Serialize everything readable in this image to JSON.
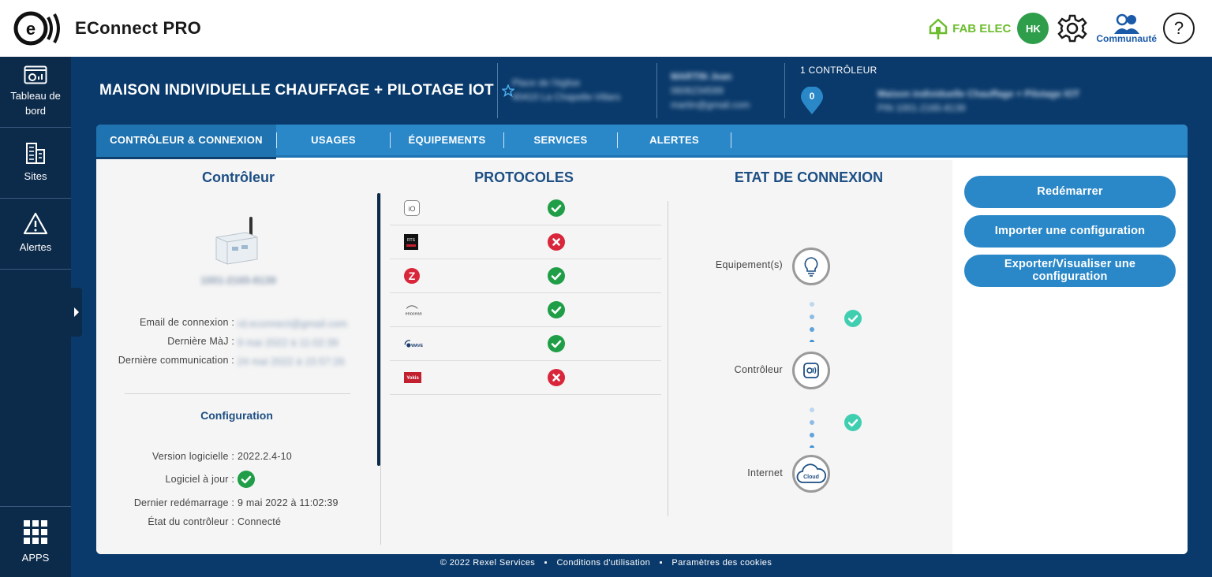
{
  "app": {
    "title": "EConnect PRO"
  },
  "topbar": {
    "brand_label": "FAB ELEC",
    "avatar_initials": "HK",
    "community_label": "Communauté",
    "help_symbol": "?"
  },
  "sidebar": {
    "items": [
      {
        "label": "Tableau de bord",
        "icon": "dashboard-icon"
      },
      {
        "label": "Sites",
        "icon": "buildings-icon"
      },
      {
        "label": "Alertes",
        "icon": "warning-icon"
      }
    ],
    "apps_label": "APPS"
  },
  "site": {
    "title": "MAISON INDIVIDUELLE CHAUFFAGE + PILOTAGE IOT",
    "address_line1": "Place de l'église",
    "address_line2": "40410 La Chapelle-Villars",
    "contact_name": "MARTIN Jean",
    "contact_phone": "0606234599",
    "contact_email": "martin@gmail.com",
    "controller_count_label": "1 CONTRÔLEUR",
    "controller_pin_value": "0",
    "controller_name": "Maison individuelle Chauffage + Pilotage IOT",
    "controller_pin": "PIN 1001-2165-8139"
  },
  "tabs": [
    {
      "label": "CONTRÔLEUR & CONNEXION",
      "active": true
    },
    {
      "label": "USAGES",
      "active": false
    },
    {
      "label": "ÉQUIPEMENTS",
      "active": false
    },
    {
      "label": "SERVICES",
      "active": false
    },
    {
      "label": "ALERTES",
      "active": false
    }
  ],
  "controller": {
    "title": "Contrôleur",
    "serial": "1001-2165-8139",
    "info": [
      {
        "label": "Email de connexion :",
        "value": "rd.econnect@gmail.com"
      },
      {
        "label": "Dernière MàJ :",
        "value": "9 mai 2022 à 11:02:39"
      },
      {
        "label": "Dernière communication :",
        "value": "24 mai 2022 à 15:57:26"
      }
    ],
    "config_title": "Configuration",
    "config": [
      {
        "label": "Version logicielle :",
        "value": "2022.2.4-10"
      },
      {
        "label": "Logiciel à jour :",
        "value": ""
      },
      {
        "label": "Dernier redémarrage :",
        "value": "9 mai 2022 à 11:02:39"
      },
      {
        "label": "État du contrôleur :",
        "value": "Connecté"
      }
    ]
  },
  "protocols": {
    "title": "PROTOCOLES",
    "items": [
      {
        "name": "io-homecontrol",
        "logo_text": "iO",
        "status": "ok"
      },
      {
        "name": "rts",
        "logo_text": "RTS",
        "status": "error"
      },
      {
        "name": "zigbee",
        "logo_text": "Z",
        "status": "ok"
      },
      {
        "name": "enocean",
        "logo_text": "enocean",
        "status": "ok"
      },
      {
        "name": "z-wave",
        "logo_text": "WAVE",
        "status": "ok"
      },
      {
        "name": "yokis",
        "logo_text": "Yokis",
        "status": "error"
      }
    ]
  },
  "connection": {
    "title": "ETAT DE CONNEXION",
    "nodes": [
      {
        "label": "Equipement(s)",
        "icon": "lightbulb-icon"
      },
      {
        "label": "Contrôleur",
        "icon": "controller-icon"
      },
      {
        "label": "Internet",
        "icon": "cloud-icon",
        "icon_text": "Cloud"
      }
    ],
    "links_status": [
      "ok",
      "ok"
    ]
  },
  "actions": {
    "restart": "Redémarrer",
    "import": "Importer une configuration",
    "export": "Exporter/Visualiser une configuration"
  },
  "footer": {
    "copyright": "© 2022 Rexel Services",
    "terms": "Conditions d'utilisation",
    "cookies": "Paramètres des cookies",
    "separator": "▪"
  },
  "colors": {
    "accent": "#2a88c9",
    "dark": "#0c2a4a",
    "ok": "#1f9e47",
    "error": "#d9263a",
    "link_ok": "#3fcfb0"
  }
}
